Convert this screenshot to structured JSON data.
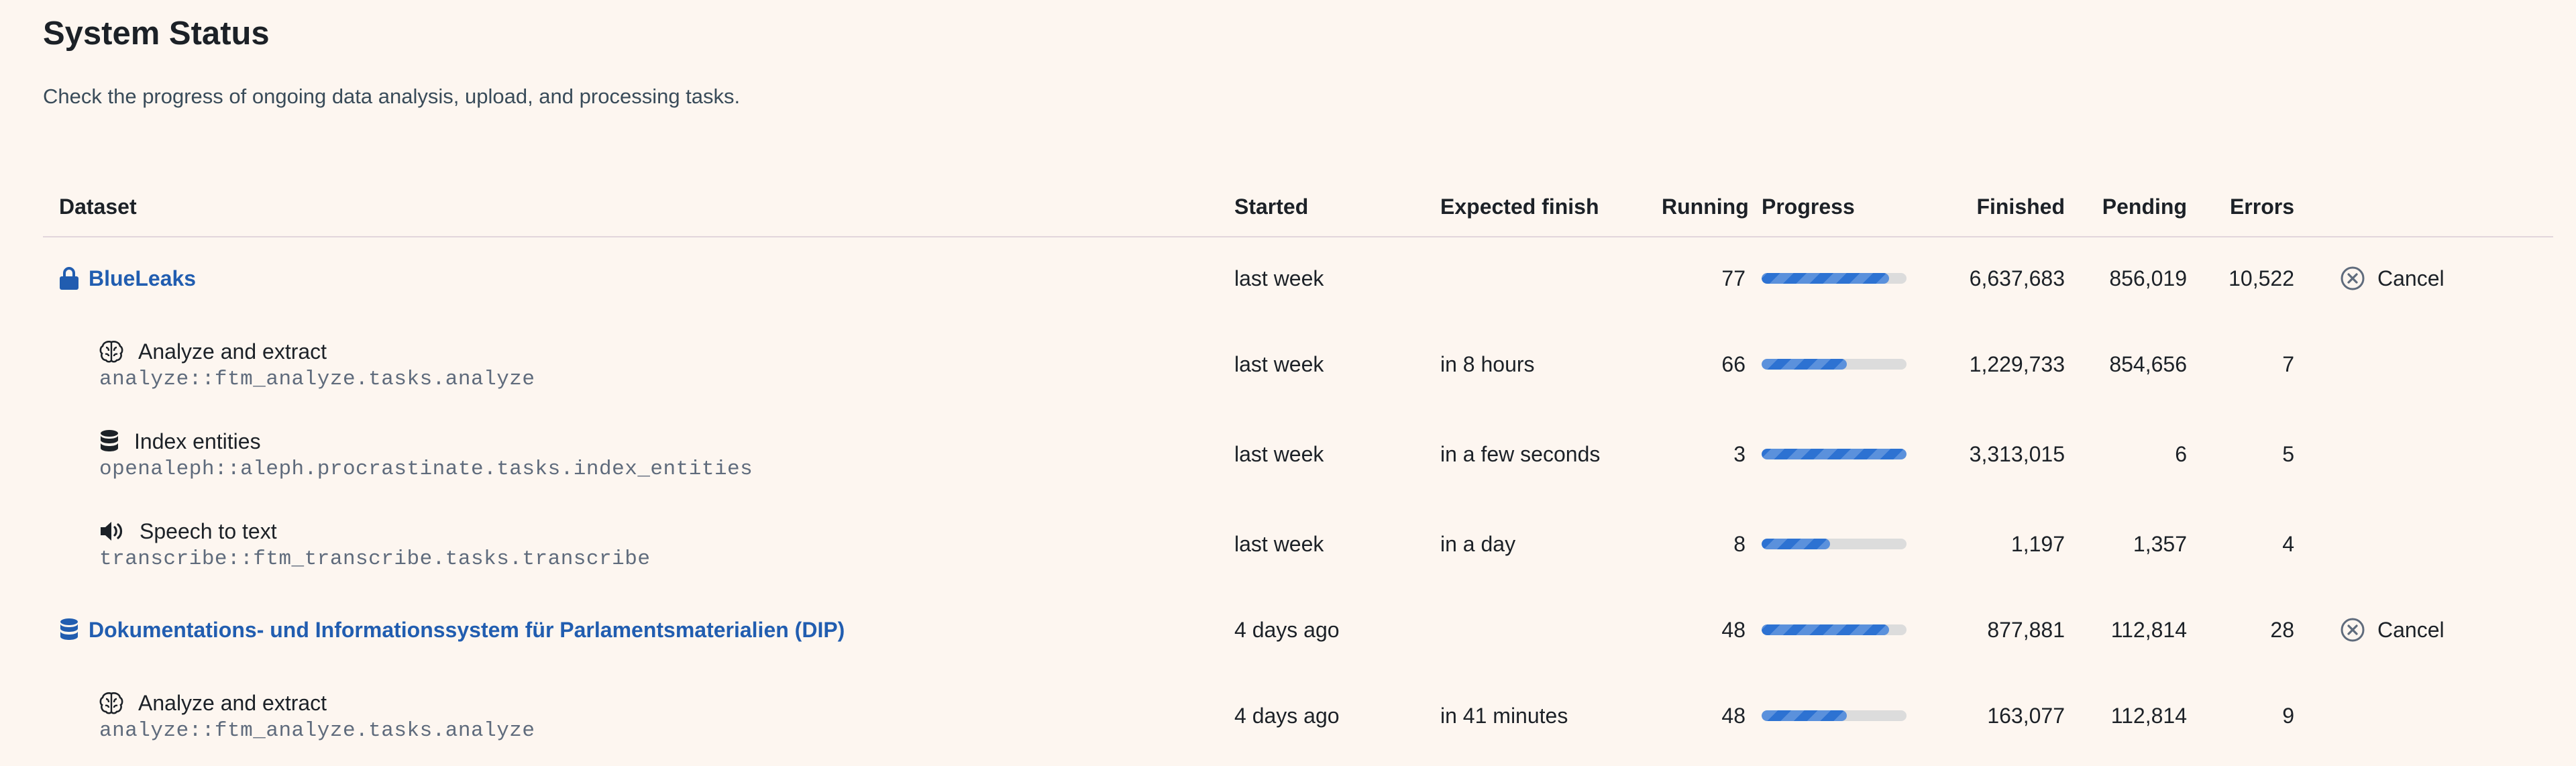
{
  "page": {
    "title": "System Status",
    "subtitle": "Check the progress of ongoing data analysis, upload, and processing tasks."
  },
  "table": {
    "headers": {
      "dataset": "Dataset",
      "started": "Started",
      "expected": "Expected finish",
      "running": "Running",
      "progress": "Progress",
      "finished": "Finished",
      "pending": "Pending",
      "errors": "Errors"
    },
    "rows": [
      {
        "kind": "collection",
        "icon": "lock-icon",
        "name": "BlueLeaks",
        "started": "last week",
        "expected": "",
        "running": "77",
        "progress": 0.88,
        "finished": "6,637,683",
        "pending": "856,019",
        "errors": "10,522",
        "action": "Cancel"
      },
      {
        "kind": "task",
        "icon": "brain-icon",
        "name": "Analyze and extract",
        "code": "analyze::ftm_analyze.tasks.analyze",
        "started": "last week",
        "expected": "in 8 hours",
        "running": "66",
        "progress": 0.59,
        "finished": "1,229,733",
        "pending": "854,656",
        "errors": "7"
      },
      {
        "kind": "task",
        "icon": "database-icon",
        "name": "Index entities",
        "code": "openaleph::aleph.procrastinate.tasks.index_entities",
        "started": "last week",
        "expected": "in a few seconds",
        "running": "3",
        "progress": 1.0,
        "finished": "3,313,015",
        "pending": "6",
        "errors": "5"
      },
      {
        "kind": "task",
        "icon": "volume-icon",
        "name": "Speech to text",
        "code": "transcribe::ftm_transcribe.tasks.transcribe",
        "started": "last week",
        "expected": "in a day",
        "running": "8",
        "progress": 0.47,
        "finished": "1,197",
        "pending": "1,357",
        "errors": "4"
      },
      {
        "kind": "collection",
        "icon": "database-icon",
        "name": "Dokumentations- und Informationssystem für Parlamentsmaterialien (DIP)",
        "started": "4 days ago",
        "expected": "",
        "running": "48",
        "progress": 0.88,
        "finished": "877,881",
        "pending": "112,814",
        "errors": "28",
        "action": "Cancel"
      },
      {
        "kind": "task",
        "icon": "brain-icon",
        "name": "Analyze and extract",
        "code": "analyze::ftm_analyze.tasks.analyze",
        "started": "4 days ago",
        "expected": "in 41 minutes",
        "running": "48",
        "progress": 0.59,
        "finished": "163,077",
        "pending": "112,814",
        "errors": "9"
      }
    ]
  },
  "colors": {
    "link": "#215db0",
    "progress": "#2d72d2",
    "track": "#dcdcdc",
    "background": "#fdf6f0"
  }
}
